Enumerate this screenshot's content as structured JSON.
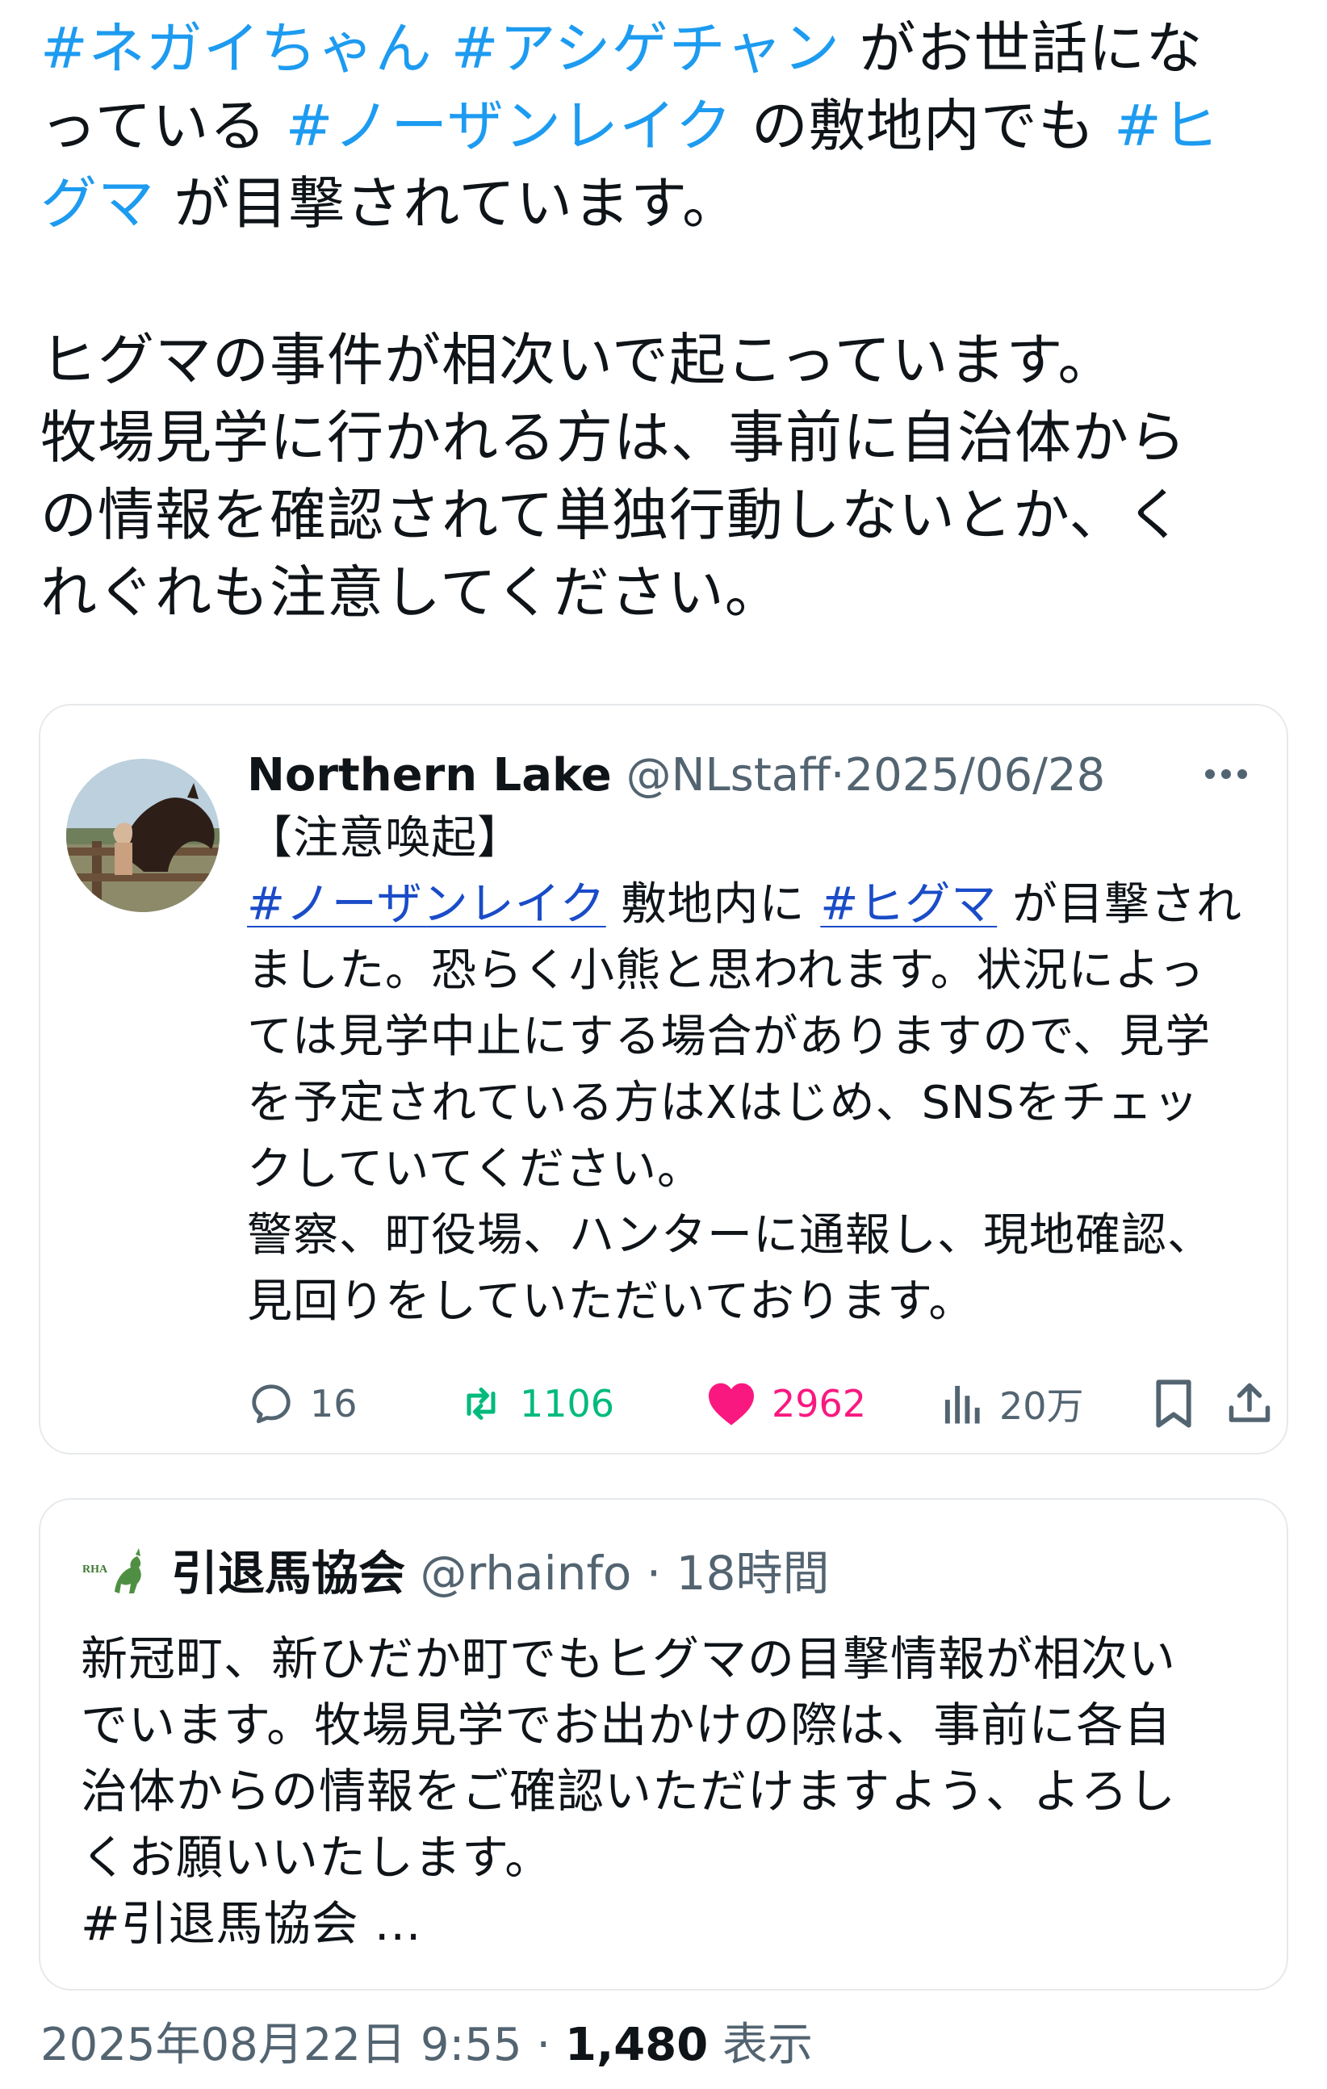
{
  "main_tweet": {
    "line1": {
      "tag1": "#ネガイちゃん",
      "tag2": "#アシゲチャン",
      "text1": "がお世話にな"
    },
    "line2": {
      "text1": "っている",
      "tag1": "#ノーザンレイク",
      "text2": "の敷地内でも",
      "tag2": "#ヒ"
    },
    "line3": {
      "tag1": "グマ",
      "text1": "が目撃されています。"
    },
    "para2": [
      "ヒグマの事件が相次いで起こっています。",
      "牧場見学に行かれる方は、事前に自治体から",
      "の情報を確認されて単独行動しないとか、く",
      "れぐれも注意してください。"
    ]
  },
  "quote1": {
    "name": "Northern Lake",
    "handle": "@NLstaff",
    "separator": "·",
    "date": "2025/06/28",
    "more_icon": "more-horizontal-icon",
    "title": "【注意喚起】",
    "line1": {
      "tag1": "#ノーザンレイク",
      "text1": "敷地内に",
      "tag2": "#ヒグマ",
      "text2": "が目撃され"
    },
    "lines": [
      "ました。恐らく小熊と思われます。状況によっ",
      "ては見学中止にする場合がありますので、見学",
      "を予定されている方はXはじめ、SNSをチェッ",
      "クしていてください。",
      "警察、町役場、ハンターに通報し、現地確認、",
      "見回りをしていただいております。"
    ],
    "stats": {
      "replies": "16",
      "retweets": "1106",
      "likes": "2962",
      "views": "20万"
    },
    "colors": {
      "retweet": "#00ba7c",
      "like": "#f91880",
      "muted": "#536471"
    }
  },
  "quote2": {
    "logo_text": "RHA",
    "name": "引退馬協会",
    "handle": "@rhainfo",
    "separator": "·",
    "time": "18時間",
    "lines": [
      "新冠町、新ひだか町でもヒグマの目撃情報が相次い",
      "でいます。牧場見学でお出かけの際は、事前に各自",
      "治体からの情報をご確認いただけますよう、よろし",
      "くお願いいたします。",
      "#引退馬協会 ..."
    ]
  },
  "footer": {
    "datetime": "2025年08月22日 9:55",
    "separator": "·",
    "views": "1,480",
    "views_label": "表示"
  },
  "accent_color": "#1d9bf0"
}
